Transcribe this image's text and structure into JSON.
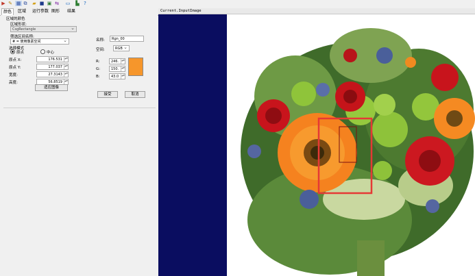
{
  "toolbar": {
    "icons": [
      "play-icon",
      "pen-icon",
      "grid-icon",
      "copy-icon",
      "folder-icon",
      "save-icon",
      "image-icon",
      "flip-icon",
      "display-icon",
      "chart-icon",
      "help-icon"
    ]
  },
  "tabs": [
    {
      "label": "颜色"
    },
    {
      "label": "区域"
    },
    {
      "label": "运行参数"
    },
    {
      "label": "图形"
    },
    {
      "label": "结果"
    }
  ],
  "panel": {
    "section_title": "区域的颜色",
    "shape_label": "区域形状:",
    "shape_value": "CsgRectangle",
    "filter_label": "筛选区间名称:",
    "filter_value": "# = 使用像素空间",
    "mode_label": "选择模式",
    "mode_options": [
      "原点",
      "中心"
    ],
    "fields": [
      {
        "label": "原点 X:",
        "value": "176.531"
      },
      {
        "label": "原点 Y:",
        "value": "177.037"
      },
      {
        "label": "宽度:",
        "value": "27.3143"
      },
      {
        "label": "高度:",
        "value": "56.8519"
      }
    ],
    "fit_button": "适应图像",
    "name_label": "名称:",
    "name_value": "Rgn_00",
    "space_label": "空间:",
    "space_value": "RGB",
    "channels": [
      {
        "label": "R:",
        "value": "246."
      },
      {
        "label": "G:",
        "value": "150."
      },
      {
        "label": "B:",
        "value": "43.0"
      }
    ],
    "swatch_color": "#f6962b",
    "accept_button": "接受",
    "cancel_button": "取消"
  },
  "image_window": {
    "title": "Current.InputImage"
  }
}
